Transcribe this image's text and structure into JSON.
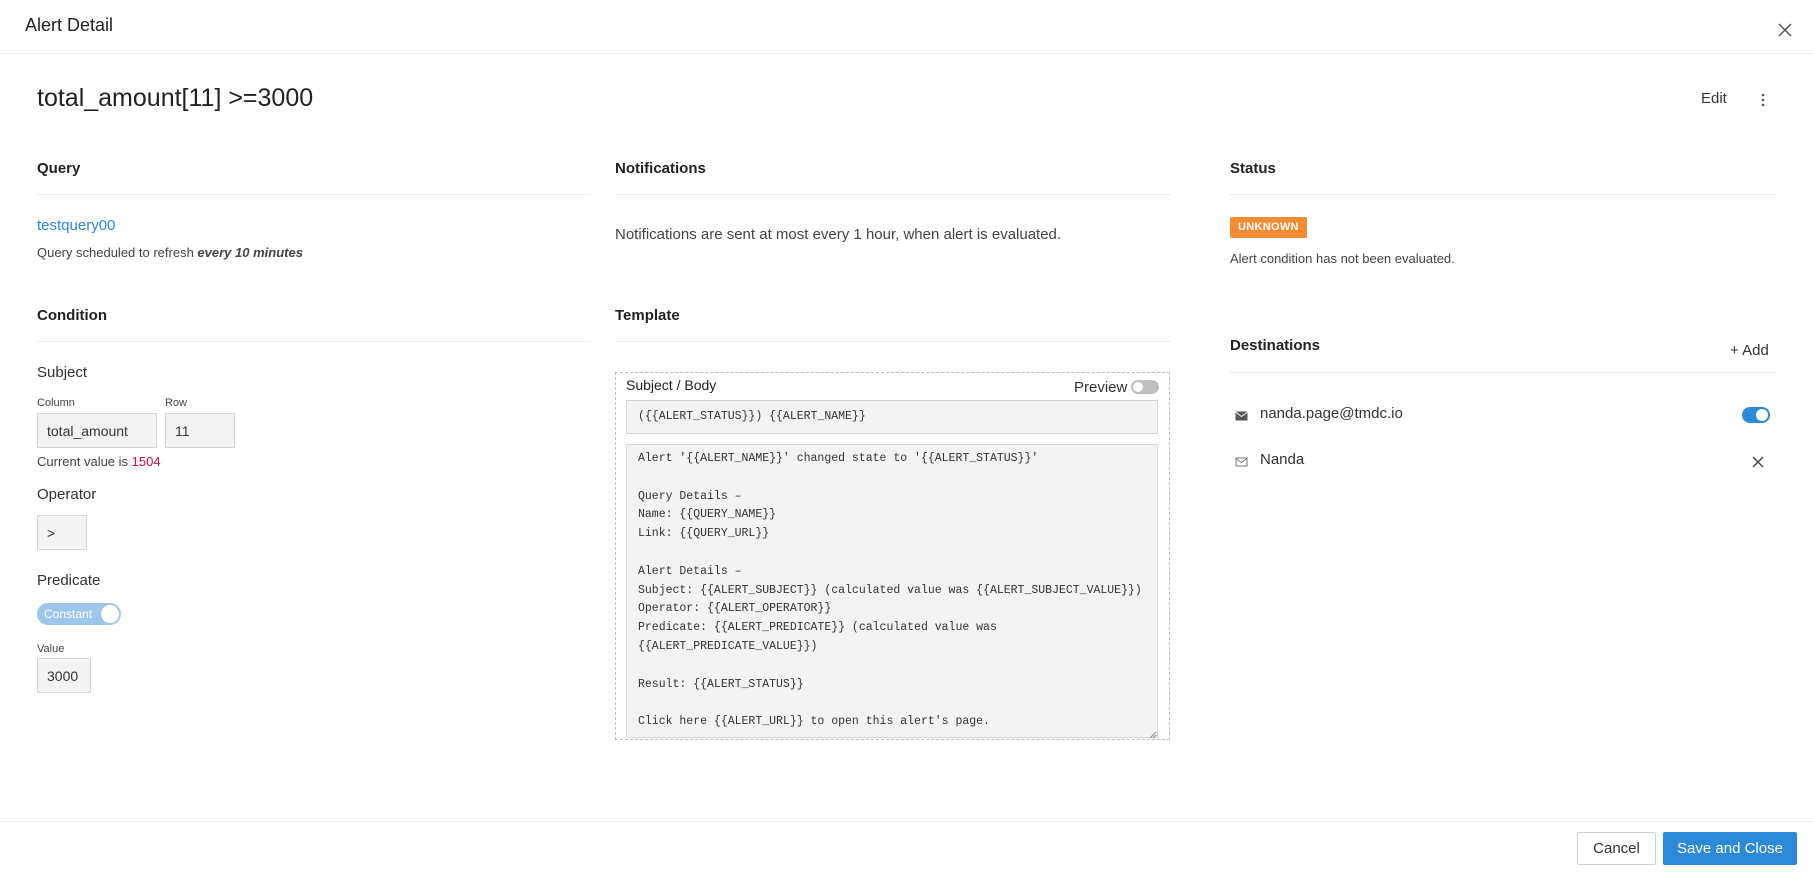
{
  "modal": {
    "title": "Alert Detail"
  },
  "alert": {
    "name": "total_amount[11] >=3000",
    "edit_label": "Edit"
  },
  "query": {
    "heading": "Query",
    "link_text": "testquery00",
    "schedule_prefix": "Query scheduled to refresh ",
    "schedule_value": "every 10 minutes"
  },
  "condition": {
    "heading": "Condition",
    "subject_title": "Subject",
    "column_label": "Column",
    "column_value": "total_amount",
    "row_label": "Row",
    "row_value": "11",
    "current_value_prefix": "Current value is ",
    "current_value": "1504",
    "operator_title": "Operator",
    "operator_value": ">",
    "predicate_title": "Predicate",
    "predicate_toggle_label": "Constant",
    "value_label": "Value",
    "value_value": "3000"
  },
  "notifications": {
    "heading": "Notifications",
    "text": "Notifications are sent at most every 1 hour, when alert is evaluated."
  },
  "template": {
    "heading": "Template",
    "box_label": "Subject / Body",
    "preview_label": "Preview",
    "preview_on": false,
    "subject": "({{ALERT_STATUS}}) {{ALERT_NAME}}",
    "body": "Alert '{{ALERT_NAME}}' changed state to '{{ALERT_STATUS}}'\n\nQuery Details –\nName: {{QUERY_NAME}}\nLink: {{QUERY_URL}}\n\nAlert Details –\nSubject: {{ALERT_SUBJECT}} (calculated value was {{ALERT_SUBJECT_VALUE}})\nOperator: {{ALERT_OPERATOR}}\nPredicate: {{ALERT_PREDICATE}} (calculated value was\n{{ALERT_PREDICATE_VALUE}})\n\nResult: {{ALERT_STATUS}}\n\nClick here {{ALERT_URL}} to open this alert's page."
  },
  "status": {
    "heading": "Status",
    "badge": "UNKNOWN",
    "badge_color": "#f28c33",
    "text": "Alert condition has not been evaluated."
  },
  "destinations": {
    "heading": "Destinations",
    "add_label": "+ Add",
    "items": [
      {
        "name": "nanda.page@tmdc.io",
        "icon": "envelope-icon",
        "control": "toggle",
        "enabled": true
      },
      {
        "name": "Nanda",
        "icon": "envelope-outline-icon",
        "control": "remove"
      }
    ]
  },
  "footer": {
    "cancel_label": "Cancel",
    "save_label": "Save and Close"
  },
  "colors": {
    "accent": "#2b89d8",
    "current_value": "#c4104b",
    "badge_unknown": "#f28c33"
  }
}
